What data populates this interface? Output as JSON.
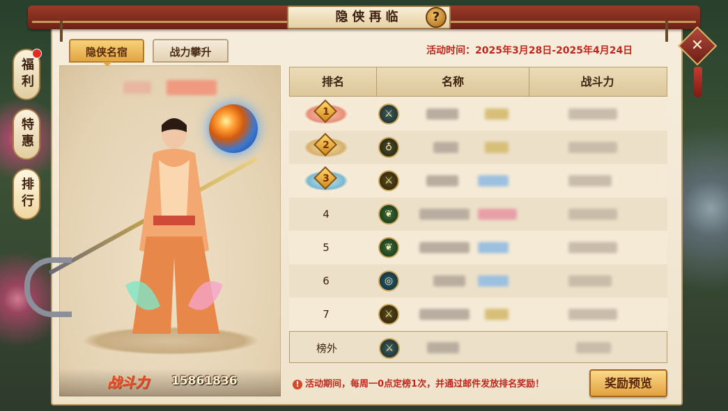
{
  "window": {
    "title": "隐侠再临",
    "help_icon": "?",
    "close_icon": "✕"
  },
  "sidebar": {
    "items": [
      {
        "label": "福利",
        "badge": true
      },
      {
        "label": "特惠",
        "badge": false
      },
      {
        "label": "排行",
        "badge": false
      }
    ]
  },
  "tabs": [
    {
      "label": "隐侠名宿",
      "active": true
    },
    {
      "label": "战力攀升",
      "active": false
    }
  ],
  "activity_time": "活动时间：2025年3月28日-2025年4月24日",
  "showcase": {
    "power_label": "战斗力",
    "power_value": "15861836"
  },
  "table": {
    "headers": [
      "排名",
      "名称",
      "战斗力"
    ],
    "rows": [
      {
        "rank": "1",
        "medal": "gold",
        "class_icon": "sword-icon"
      },
      {
        "rank": "2",
        "medal": "silver",
        "class_icon": "gourd-icon"
      },
      {
        "rank": "3",
        "medal": "blue",
        "class_icon": "blade-icon"
      },
      {
        "rank": "4",
        "medal": "",
        "class_icon": "butterfly-icon"
      },
      {
        "rank": "5",
        "medal": "",
        "class_icon": "butterfly-icon"
      },
      {
        "rank": "6",
        "medal": "",
        "class_icon": "ring-icon"
      },
      {
        "rank": "7",
        "medal": "",
        "class_icon": "blade-icon"
      }
    ],
    "self_row": {
      "rank": "榜外",
      "class_icon": "sword-icon"
    }
  },
  "footnote": "活动期间，每周一0点定榜1次，并通过邮件发放排名奖励！",
  "reward_button": "奖励预览",
  "colors": {
    "accent_red": "#c0271c",
    "gold": "#e2a140",
    "parchment": "#f4ead6"
  }
}
